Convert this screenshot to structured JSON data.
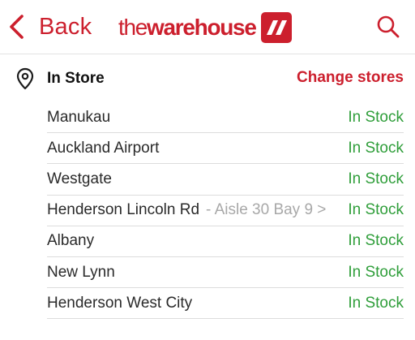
{
  "header": {
    "back_label": "Back",
    "logo_the": "the",
    "logo_warehouse": "warehouse",
    "brand_color": "#cc1f2d"
  },
  "store_section": {
    "title": "In Store",
    "change_label": "Change stores",
    "stock_color": "#2f9e3a"
  },
  "stores": [
    {
      "name": "Manukau",
      "aisle": "",
      "status": "In Stock"
    },
    {
      "name": "Auckland Airport",
      "aisle": "",
      "status": "In Stock"
    },
    {
      "name": "Westgate",
      "aisle": "",
      "status": "In Stock"
    },
    {
      "name": "Henderson Lincoln Rd",
      "aisle": "- Aisle 30 Bay 9 >",
      "status": "In Stock"
    },
    {
      "name": "Albany",
      "aisle": "",
      "status": "In Stock"
    },
    {
      "name": "New Lynn",
      "aisle": "",
      "status": "In Stock"
    },
    {
      "name": "Henderson West City",
      "aisle": "",
      "status": "In Stock"
    }
  ]
}
